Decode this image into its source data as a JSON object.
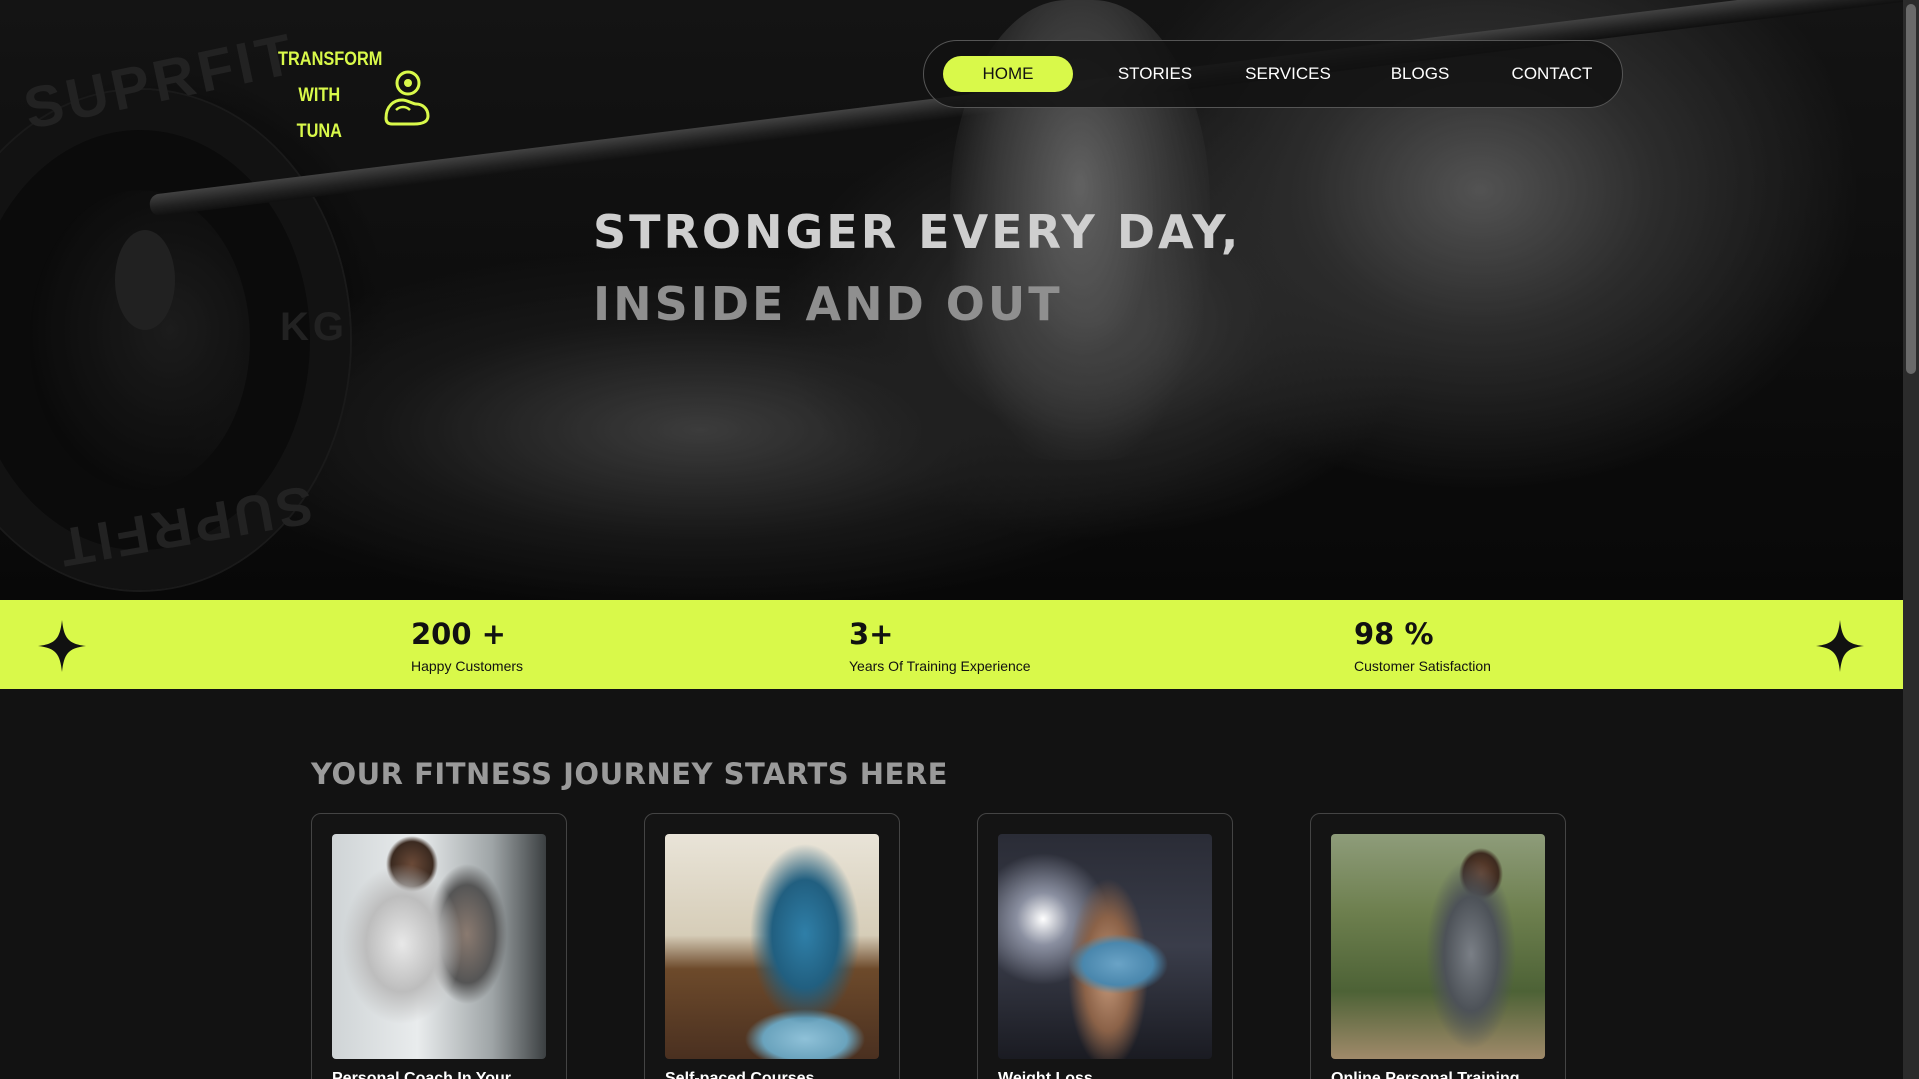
{
  "brand": {
    "line1": "TRANSFORM",
    "line2": "WITH TUNA",
    "accent_color": "#d9f94a",
    "icon": "flexed-arm-icon"
  },
  "nav": {
    "items": [
      {
        "label": "HOME",
        "active": true
      },
      {
        "label": "STORIES",
        "active": false
      },
      {
        "label": "SERVICES",
        "active": false
      },
      {
        "label": "BLOGS",
        "active": false
      },
      {
        "label": "CONTACT",
        "active": false
      }
    ]
  },
  "hero": {
    "title_line1": "STRONGER EVERY DAY,",
    "title_line2": "INSIDE AND OUT",
    "plate_text_top": "SUPRFIT",
    "plate_text_mid": "KG",
    "plate_text_bottom": "SUPRFIT"
  },
  "stats": {
    "items": [
      {
        "value": "200 +",
        "label": "Happy Customers"
      },
      {
        "value": "3+",
        "label": "Years Of Training Experience"
      },
      {
        "value": "98 %",
        "label": "Customer Satisfaction"
      }
    ],
    "decor_icon": "four-point-star-icon"
  },
  "section": {
    "title": "YOUR FITNESS JOURNEY STARTS HERE",
    "cards": [
      {
        "image": "personal-trainer-photo",
        "caption": "Personal Coach In Your..."
      },
      {
        "image": "yoga-stretch-photo",
        "caption": "Self-paced Courses"
      },
      {
        "image": "woman-gym-mat-photo",
        "caption": "Weight Loss"
      },
      {
        "image": "trail-runner-photo",
        "caption": "Online Personal Training"
      }
    ]
  }
}
